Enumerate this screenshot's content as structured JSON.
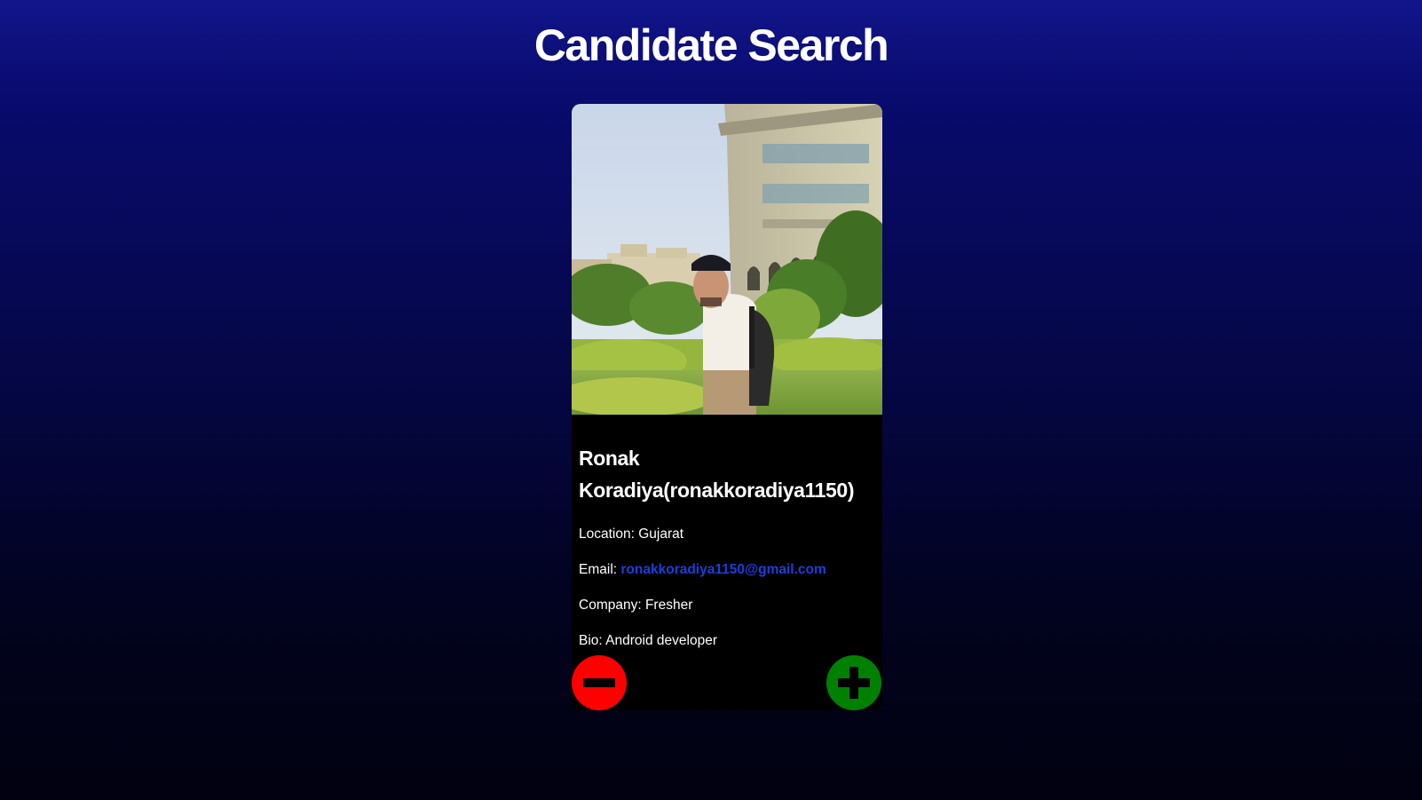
{
  "header": {
    "title": "Candidate Search"
  },
  "candidate": {
    "photo_alt": "Ronak Koradiya",
    "name_line1": "Ronak",
    "name_line2": "Koradiya(ronakkoradiya1150)",
    "location_label": "Location:",
    "location_value": "Gujarat",
    "email_label": "Email:",
    "email_value": "ronakkoradiya1150@gmail.com",
    "company_label": "Company:",
    "company_value": "Fresher",
    "bio_label": "Bio:",
    "bio_value": "Android developer"
  },
  "actions": {
    "reject_icon": "minus-icon",
    "accept_icon": "plus-icon",
    "reject_color": "#ff0000",
    "accept_color": "#008000"
  },
  "colors": {
    "email_link": "#1c3fd9",
    "card_bg": "#000000"
  }
}
